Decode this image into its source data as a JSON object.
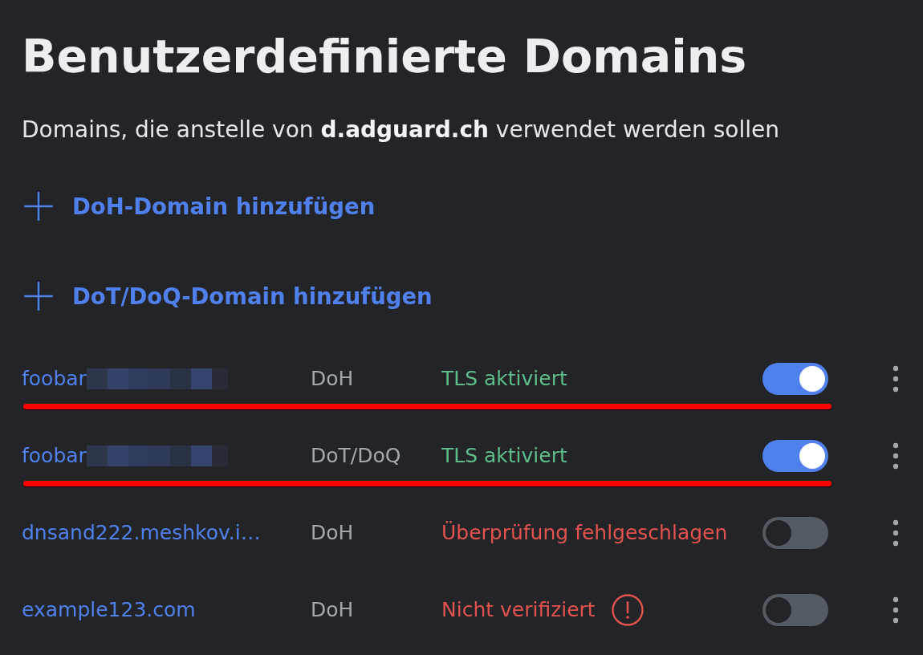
{
  "title": "Benutzerdefinierte Domains",
  "subtitle": "Domains, die anstelle von **d.adguard.ch** verwendet werden sollen",
  "add_actions": [
    {
      "label": "DoH-Domain hinzufügen"
    },
    {
      "label": "DoT/DoQ-Domain hinzufügen"
    }
  ],
  "domains": [
    {
      "name": "foobar",
      "redacted": true,
      "protocol": "DoH",
      "status": "TLS aktiviert",
      "status_ok": true,
      "warning": false,
      "enabled": true,
      "underlined": true
    },
    {
      "name": "foobar",
      "redacted": true,
      "protocol": "DoT/DoQ",
      "status": "TLS aktiviert",
      "status_ok": true,
      "warning": false,
      "enabled": true,
      "underlined": true
    },
    {
      "name": "dnsand222.meshkov.i…",
      "redacted": false,
      "protocol": "DoH",
      "status": "Überprüfung fehlgeschlagen",
      "status_ok": false,
      "warning": false,
      "enabled": false,
      "underlined": false
    },
    {
      "name": "example123.com",
      "redacted": false,
      "protocol": "DoH",
      "status": "Nicht verifiziert",
      "status_ok": false,
      "warning": true,
      "enabled": false,
      "underlined": false
    }
  ]
}
